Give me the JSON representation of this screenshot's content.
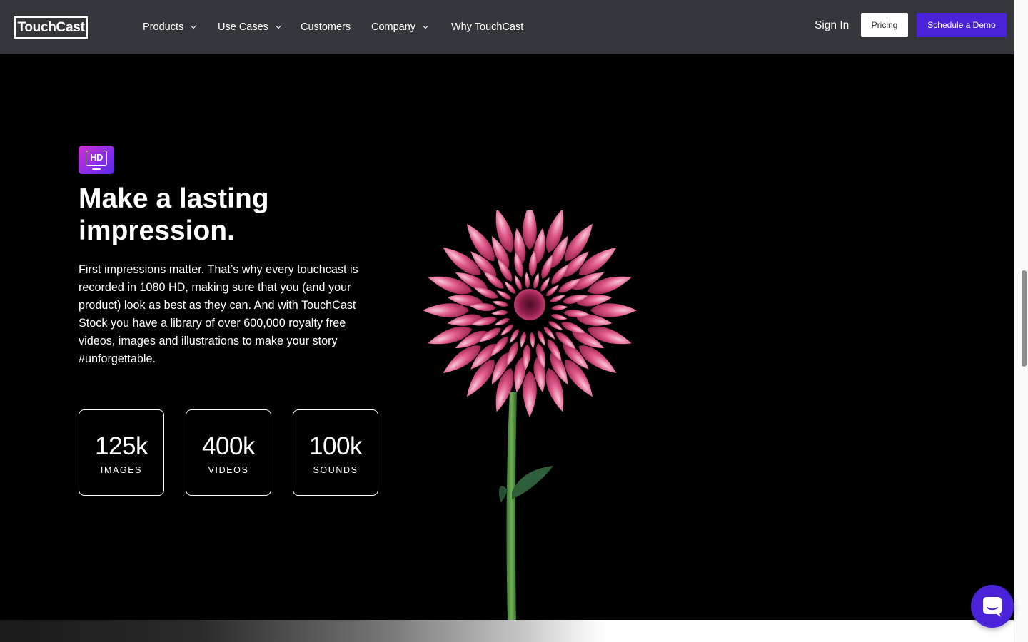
{
  "nav": {
    "logo": "TouchCast",
    "items": [
      {
        "label": "Products",
        "dropdown": true
      },
      {
        "label": "Use Cases",
        "dropdown": true
      },
      {
        "label": "Customers",
        "dropdown": false
      },
      {
        "label": "Company",
        "dropdown": true
      },
      {
        "label": "Why TouchCast",
        "dropdown": false
      }
    ],
    "sign_in": "Sign In",
    "pricing": "Pricing",
    "demo": "Schedule a Demo"
  },
  "hero": {
    "badge_icon": "hd-icon",
    "badge_text": "HD",
    "headline_line1": "Make a lasting",
    "headline_line2": "impression.",
    "body": "First impressions matter. That’s why every touchcast is recorded in 1080 HD, making sure that you (and your product) look as best as they can. And with TouchCast Stock you have a library of over 600,000 royalty free videos, images and illustrations to make your story #unforgettable.",
    "stats": [
      {
        "value": "125k",
        "label": "IMAGES"
      },
      {
        "value": "400k",
        "label": "VIDEOS"
      },
      {
        "value": "100k",
        "label": "SOUNDS"
      }
    ]
  },
  "chat": {
    "icon": "chat-icon"
  },
  "colors": {
    "nav_bg": "#35363b",
    "accent": "#4a23d8",
    "page_bg": "#000000",
    "badge_gradient_start": "#d42fd4",
    "badge_gradient_end": "#5b2be3"
  }
}
